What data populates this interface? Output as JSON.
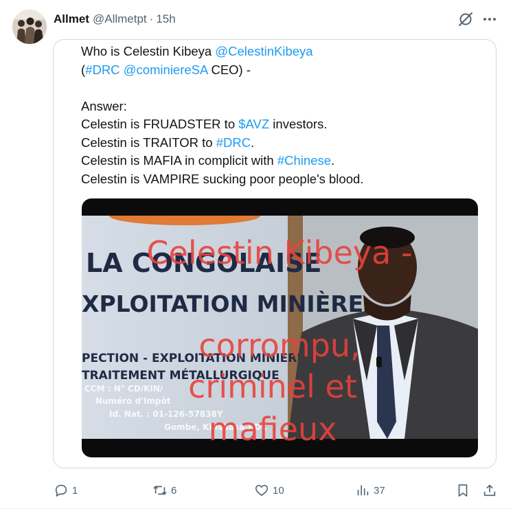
{
  "post": {
    "author_name": "Allmet",
    "author_handle": "@Allmetpt",
    "separator": "·",
    "time": "15h"
  },
  "quoted": {
    "lines": [
      [
        {
          "t": "Who is Celestin Kibeya "
        },
        {
          "t": "@CelestinKibeya",
          "link": true
        }
      ],
      [
        {
          "t": "("
        },
        {
          "t": "#DRC",
          "link": true
        },
        {
          "t": " "
        },
        {
          "t": "@cominiereSA",
          "link": true
        },
        {
          "t": " CEO) -"
        }
      ],
      [],
      [
        {
          "t": "Answer:"
        }
      ],
      [
        {
          "t": "Celestin is FRUADSTER to "
        },
        {
          "t": "$AVZ",
          "link": true
        },
        {
          "t": " investors."
        }
      ],
      [
        {
          "t": "Celestin is TRAITOR to "
        },
        {
          "t": "#DRC",
          "link": true
        },
        {
          "t": "."
        }
      ],
      [
        {
          "t": "Celestin is MAFIA in complicit with "
        },
        {
          "t": "#Chinese",
          "link": true
        },
        {
          "t": "."
        }
      ],
      [
        {
          "t": "Celestin is VAMPIRE sucking poor people's blood."
        }
      ]
    ]
  },
  "video": {
    "sign_lines": [
      "LA CONGOLAISE",
      "XPLOITATION MINIÈRE",
      "PECTION - EXPLOITATION MINIÈRE",
      "TRAITEMENT MÉTALLURGIQUE",
      "CCM : N° CD/KIN/",
      "Numéro d'Impôt",
      "Id. Nat. : 01-126-57838Y",
      "Gombe, Kinshasa-RDC"
    ],
    "overlay_lines": [
      "Celestin Kibeya -",
      "corrompu,",
      "criminel et",
      "mafieux"
    ]
  },
  "actions": {
    "replies": "1",
    "reposts": "6",
    "likes": "10",
    "views": "37"
  },
  "colors": {
    "link": "#1d9bf0",
    "muted": "#536471",
    "overlay_text": "#e8413c"
  }
}
